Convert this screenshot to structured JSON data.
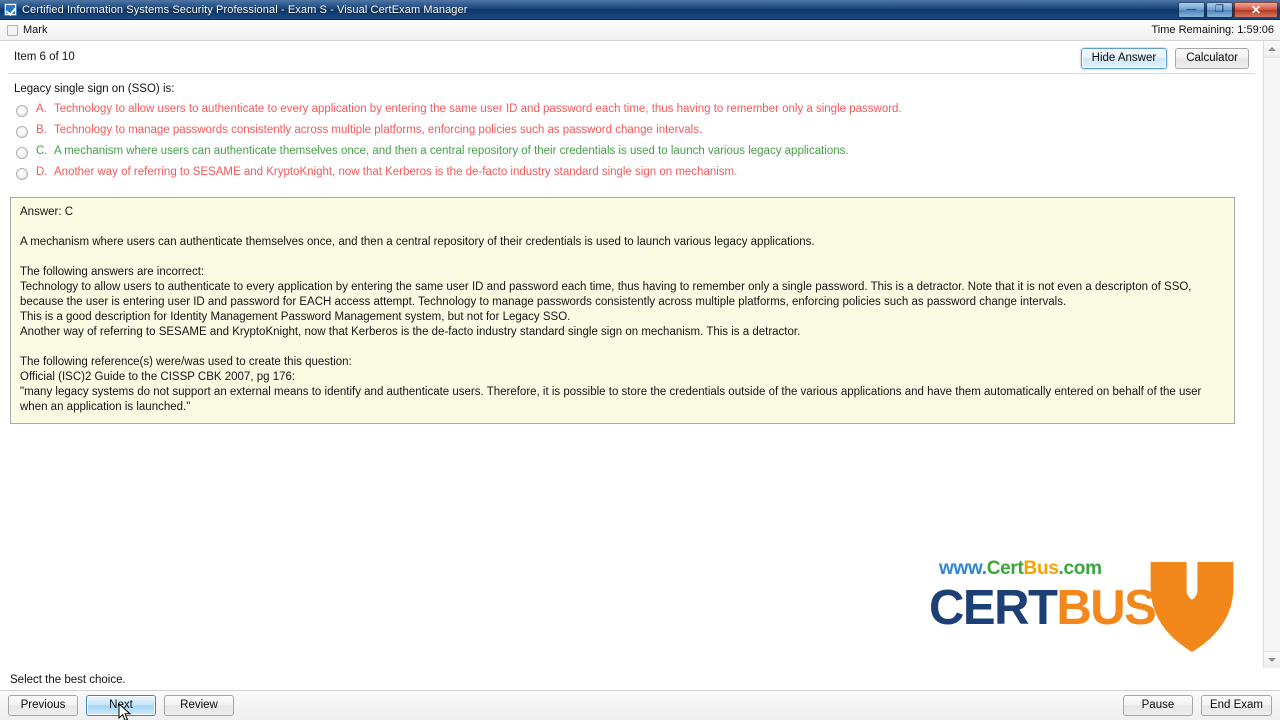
{
  "window": {
    "title": "Certified Information Systems Security Professional - Exam S - Visual CertExam Manager",
    "icon": "checkbox-icon",
    "minimize_glyph": "—",
    "maximize_glyph": "❐",
    "close_glyph": "✕"
  },
  "toolbar": {
    "mark_label": "Mark",
    "time_label": "Time Remaining: 1:59:06"
  },
  "header": {
    "item_counter": "Item 6 of 10",
    "hide_answer_label": "Hide Answer",
    "calculator_label": "Calculator"
  },
  "question": {
    "text": "Legacy single sign on (SSO) is:",
    "options": [
      {
        "letter": "A.",
        "text": "Technology to allow users to authenticate to every application by entering the same user ID and password each time, thus having to remember only a single password.",
        "state": "wrong",
        "selected": false
      },
      {
        "letter": "B.",
        "text": "Technology to manage passwords consistently across multiple platforms, enforcing policies such as password change intervals.",
        "state": "wrong",
        "selected": false
      },
      {
        "letter": "C.",
        "text": "A mechanism where users can authenticate themselves once, and then a central repository of their credentials is used to launch various legacy applications.",
        "state": "right",
        "selected": false
      },
      {
        "letter": "D.",
        "text": "Another way of referring to SESAME and KryptoKnight, now that Kerberos is the de-facto industry standard single sign on mechanism.",
        "state": "wrong",
        "selected": false
      }
    ]
  },
  "answer_panel": {
    "lines": [
      "Answer: C",
      "",
      "A mechanism where users can authenticate themselves once, and then a central repository of their credentials is used to launch various legacy applications.",
      "",
      "The following answers are incorrect:",
      "Technology to allow users to authenticate to every application by entering the same user ID and password each time, thus having to remember only a single password. This is a detractor. Note that it is not even a descripton of SSO, because the user is entering user ID and password for EACH access attempt. Technology to manage passwords consistently across multiple platforms, enforcing policies such as password change intervals.",
      "This is a good description for Identity Management Password Management system, but not for Legacy SSO.",
      "Another way of referring to SESAME and KryptoKnight, now that Kerberos is the de-facto industry standard single sign on mechanism. This is a detractor.",
      "",
      "The following reference(s) were/was used to create this question:",
      "Official (ISC)2 Guide to the CISSP CBK 2007, pg 176:",
      "\"many legacy systems do not support an external means to identify and authenticate users. Therefore, it is possible to store the credentials outside of the various applications and have them automatically entered on behalf of the user when an application is launched.\""
    ]
  },
  "logo": {
    "url_parts": [
      {
        "text": "www.",
        "color": "#2f86d0"
      },
      {
        "text": "Cert",
        "color": "#3aa63a"
      },
      {
        "text": "Bus",
        "color": "#f5a400"
      },
      {
        "text": ".com",
        "color": "#3aa63a"
      }
    ],
    "word_parts": [
      {
        "text": "CERT",
        "color": "#1c3f76"
      },
      {
        "text": "BUS",
        "color": "#f2881b"
      }
    ]
  },
  "status": {
    "hint": "Select the best choice."
  },
  "navigation": {
    "previous_label": "Previous",
    "next_label": "Next",
    "review_label": "Review",
    "pause_label": "Pause",
    "end_exam_label": "End Exam"
  },
  "scrollbar": {
    "up_arrow": "scroll-up-arrow",
    "down_arrow": "scroll-down-arrow"
  }
}
